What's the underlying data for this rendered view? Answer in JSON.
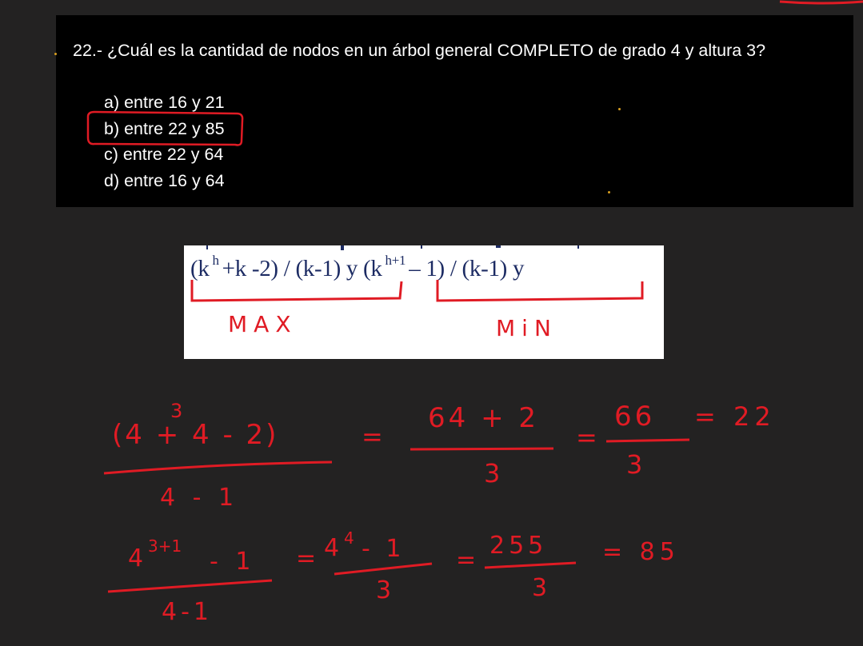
{
  "question": {
    "text": "22.- ¿Cuál es la cantidad de nodos en un árbol general COMPLETO de grado 4 y altura 3?",
    "options": [
      "a) entre 16 y 21",
      "b) entre 22 y 85",
      "c) entre 22 y 64",
      "d) entre 16 y 64"
    ],
    "selected_option": 1
  },
  "formula": {
    "max_expr": "(k h +k -2) / (k-1)",
    "conj1": "y",
    "min_expr": "(k h+1 – 1) / (k-1)",
    "conj2": "y",
    "max_label": "MAX",
    "min_label": "MiN"
  },
  "handwriting": {
    "line1": {
      "num": "(4  + 4 - 2)",
      "exp": "3",
      "den": "4 - 1",
      "eq1": "=",
      "num2": "64 + 2",
      "den2": "3",
      "eq2": "=",
      "num3": "66",
      "den3": "3",
      "eq3": "= 22"
    },
    "line2": {
      "num_base": "4",
      "num_exp": "3+1",
      "num_tail": "- 1",
      "den": "4-1",
      "eq1": "=",
      "num2_base": "4",
      "num2_exp": "4",
      "num2_tail": "- 1",
      "den2": "3",
      "eq2": "=",
      "num3": "255",
      "den3": "3",
      "eq3": "= 85"
    }
  },
  "colors": {
    "annotation": "#e01b24",
    "formula_text": "#1c2b63"
  }
}
